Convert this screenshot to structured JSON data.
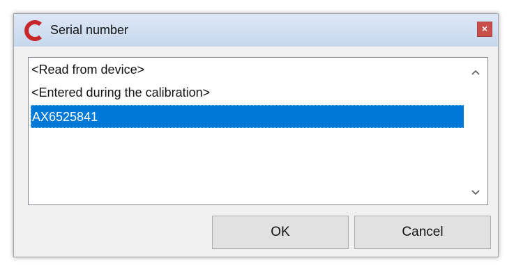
{
  "window": {
    "title": "Serial number",
    "close_glyph": "×",
    "logo_icon": "app-c-logo-icon",
    "accent_color": "#c8262a"
  },
  "list": {
    "items": [
      {
        "label": "<Read from device>",
        "selected": false
      },
      {
        "label": "<Entered during the calibration>",
        "selected": false
      },
      {
        "label": "AX6525841",
        "selected": true
      }
    ],
    "selection_color": "#0078d7",
    "scroll_up_glyph": "▲",
    "scroll_down_glyph": "▼"
  },
  "buttons": {
    "ok_label": "OK",
    "cancel_label": "Cancel"
  }
}
